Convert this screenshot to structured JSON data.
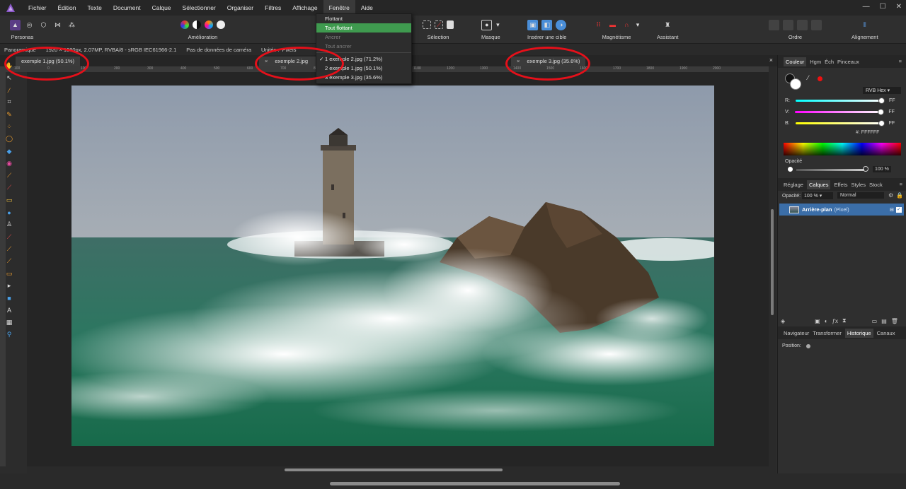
{
  "app": {
    "menus": [
      "Fichier",
      "Édition",
      "Texte",
      "Document",
      "Calque",
      "Sélectionner",
      "Organiser",
      "Filtres",
      "Affichage",
      "Fenêtre",
      "Aide"
    ],
    "active_menu_index": 9,
    "window_controls": [
      "—",
      "☐",
      "✕"
    ]
  },
  "toolbar": {
    "personas_label": "Personas",
    "amelioration_label": "Amélioration",
    "selection_label": "Sélection",
    "masque_label": "Masque",
    "inserer_label": "Insérer une cible",
    "magnetisme_label": "Magnétisme",
    "assistant_label": "Assistant",
    "ordre_label": "Ordre",
    "alignement_label": "Alignement"
  },
  "contextbar": {
    "tool": "Panoramique",
    "doc_info": "1920 × 1080px, 2.07MP, RVBA/8 - sRGB IEC61966-2.1",
    "camera": "Pas de données de caméra",
    "units_label": "Unités :",
    "units_value": "Pixels"
  },
  "tabs": [
    {
      "label": "exemple 1.jpg (50.1%)"
    },
    {
      "label": "exemple 2.jpg (71.2%)"
    },
    {
      "label": "exemple 3.jpg (35.6%)"
    }
  ],
  "window_menu": {
    "items": [
      "Flottant",
      "Tout flottant",
      "Ancrer",
      "Tout ancrer"
    ],
    "docs": [
      "1 exemple 2.jpg (71.2%)",
      "2 exemple 1.jpg (50.1%)",
      "3 exemple 3.jpg (35.6%)"
    ],
    "highlighted": "Tout flottant",
    "checked_doc_index": 0
  },
  "ruler": {
    "ticks": [
      "100",
      "0",
      "100",
      "200",
      "300",
      "400",
      "500",
      "600",
      "700",
      "800",
      "900",
      "1000",
      "1100",
      "1200",
      "1300",
      "1400",
      "1500",
      "1600",
      "1700",
      "1800",
      "1900",
      "2000"
    ]
  },
  "color_panel": {
    "tabs": [
      "Couleur",
      "Hgm",
      "Éch",
      "Pinceaux"
    ],
    "mode": "RVB Hex",
    "r_label": "R:",
    "r_value": "FF",
    "v_label": "V:",
    "v_value": "FF",
    "b_label": "B:",
    "b_value": "FF",
    "hex_label": "#:",
    "hex_value": "FFFFFF",
    "opacity_label": "Opacité",
    "opacity_value": "100 %"
  },
  "layers_panel": {
    "tabs": [
      "Réglage",
      "Calques",
      "Effets",
      "Styles",
      "Stock"
    ],
    "opacity_label": "Opacité:",
    "opacity_value": "100 %",
    "blend_mode": "Normal",
    "layer_name": "Arrière-plan",
    "layer_type": "(Pixel)"
  },
  "history_panel": {
    "tabs": [
      "Navigateur",
      "Transformer",
      "Historique",
      "Canaux"
    ],
    "position_label": "Position:"
  },
  "colors": {
    "accent_green": "#3f9a4f",
    "annotation_red": "#e5101a",
    "layer_selected": "#3b6ea8"
  }
}
